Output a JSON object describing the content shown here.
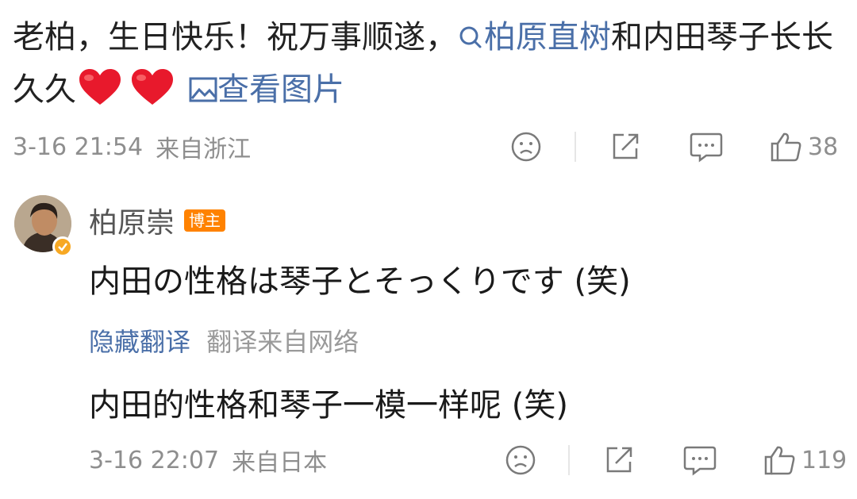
{
  "comment": {
    "text_before": "老柏，生日快乐！祝万事顺遂，",
    "mention_link": "柏原直树",
    "text_middle": "和内田琴子长长久久",
    "view_image_link": "查看图片",
    "timestamp": "3-16 21:54",
    "location": "来自浙江",
    "like_count": "38"
  },
  "reply": {
    "author": "柏原崇",
    "badge": "博主",
    "text": "内田の性格は琴子とそっくりです (笑)",
    "hide_translation": "隐藏翻译",
    "translation_source": "翻译来自网络",
    "translated_text": "内田的性格和琴子一模一样呢 (笑)",
    "timestamp": "3-16 22:07",
    "location": "来自日本",
    "like_count": "119"
  },
  "icons": [
    "search-icon",
    "heart-icon",
    "image-icon",
    "sad-face-icon",
    "share-icon",
    "comment-icon",
    "thumbs-up-icon",
    "verified-icon"
  ],
  "colors": {
    "link": "#4a6fa8",
    "badge": "#ff8200",
    "heart": "#e8192c",
    "verified": "#f7a823",
    "muted": "#8e8e8e"
  }
}
